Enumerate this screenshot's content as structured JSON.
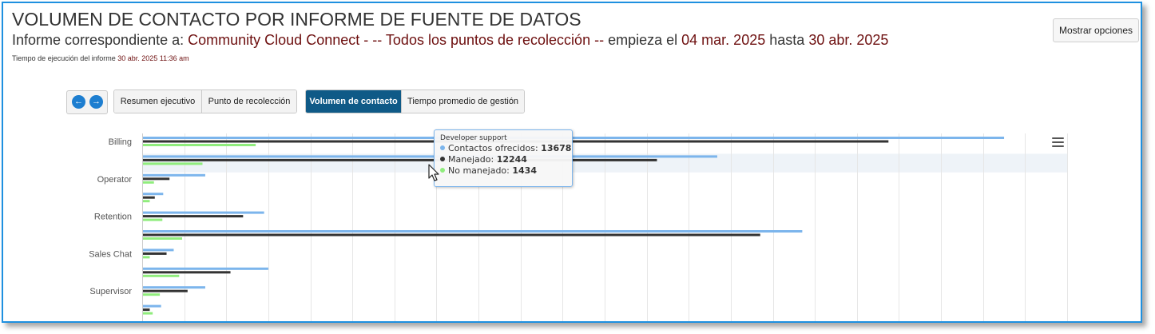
{
  "header": {
    "title": "VOLUMEN DE CONTACTO POR INFORME DE FUENTE DE DATOS",
    "subtitle_prefix": "Informe correspondiente a:",
    "account": "Community Cloud Connect",
    "sep1": "  - -- ",
    "collection": "Todos los puntos de recolección",
    "sep2": " --  ",
    "starts_label": "empieza el",
    "start_date": "04 mar. 2025",
    "until_label": "hasta",
    "end_date": "30 abr. 2025",
    "runtime_label": "Tiempo de ejecución del informe",
    "runtime_value": "30 abr. 2025 11:36 am"
  },
  "options_button": "Mostrar opciones",
  "nav": {
    "prev_icon": "arrow-left-icon",
    "next_icon": "arrow-right-icon"
  },
  "tabs_group1": [
    "Resumen ejecutivo",
    "Punto de recolección"
  ],
  "tabs_group2": [
    "Volumen de contacto",
    "Tiempo promedio de gestión"
  ],
  "active_tab": "Volumen de contacto",
  "tooltip": {
    "category": "Developer support",
    "rows": [
      {
        "label": "Contactos ofrecidos:",
        "value": "13678",
        "color": "#7cb5ec"
      },
      {
        "label": "Manejado:",
        "value": "12244",
        "color": "#333333"
      },
      {
        "label": "No manejado:",
        "value": "1434",
        "color": "#90ed7d"
      }
    ]
  },
  "colors": {
    "offered": "#7cb5ec",
    "handled": "#333333",
    "unhandled": "#90ed7d",
    "accent": "#0f5a87",
    "highlight": "#6d0f0f"
  },
  "chart_data": {
    "type": "bar",
    "orientation": "horizontal",
    "categories": [
      "Billing",
      "Developer support",
      "Operator",
      "",
      "Retention",
      "",
      "Sales Chat",
      "",
      "Supervisor",
      ""
    ],
    "visible_labels": [
      "Billing",
      "Operator",
      "Retention",
      "Sales Chat",
      "Supervisor"
    ],
    "series": [
      {
        "key": "offered",
        "values": [
          20500,
          13678,
          1500,
          500,
          2900,
          15700,
          750,
          3000,
          1500,
          450
        ]
      },
      {
        "key": "handled",
        "values": [
          17750,
          12244,
          650,
          300,
          2400,
          14700,
          580,
          2100,
          1080,
          180
        ]
      },
      {
        "key": "unhandled",
        "values": [
          2700,
          1434,
          280,
          180,
          480,
          950,
          180,
          880,
          420,
          250
        ]
      }
    ],
    "xlim": [
      0,
      22000
    ],
    "highlighted_category": "Developer support",
    "grid": true,
    "legend": "none"
  }
}
